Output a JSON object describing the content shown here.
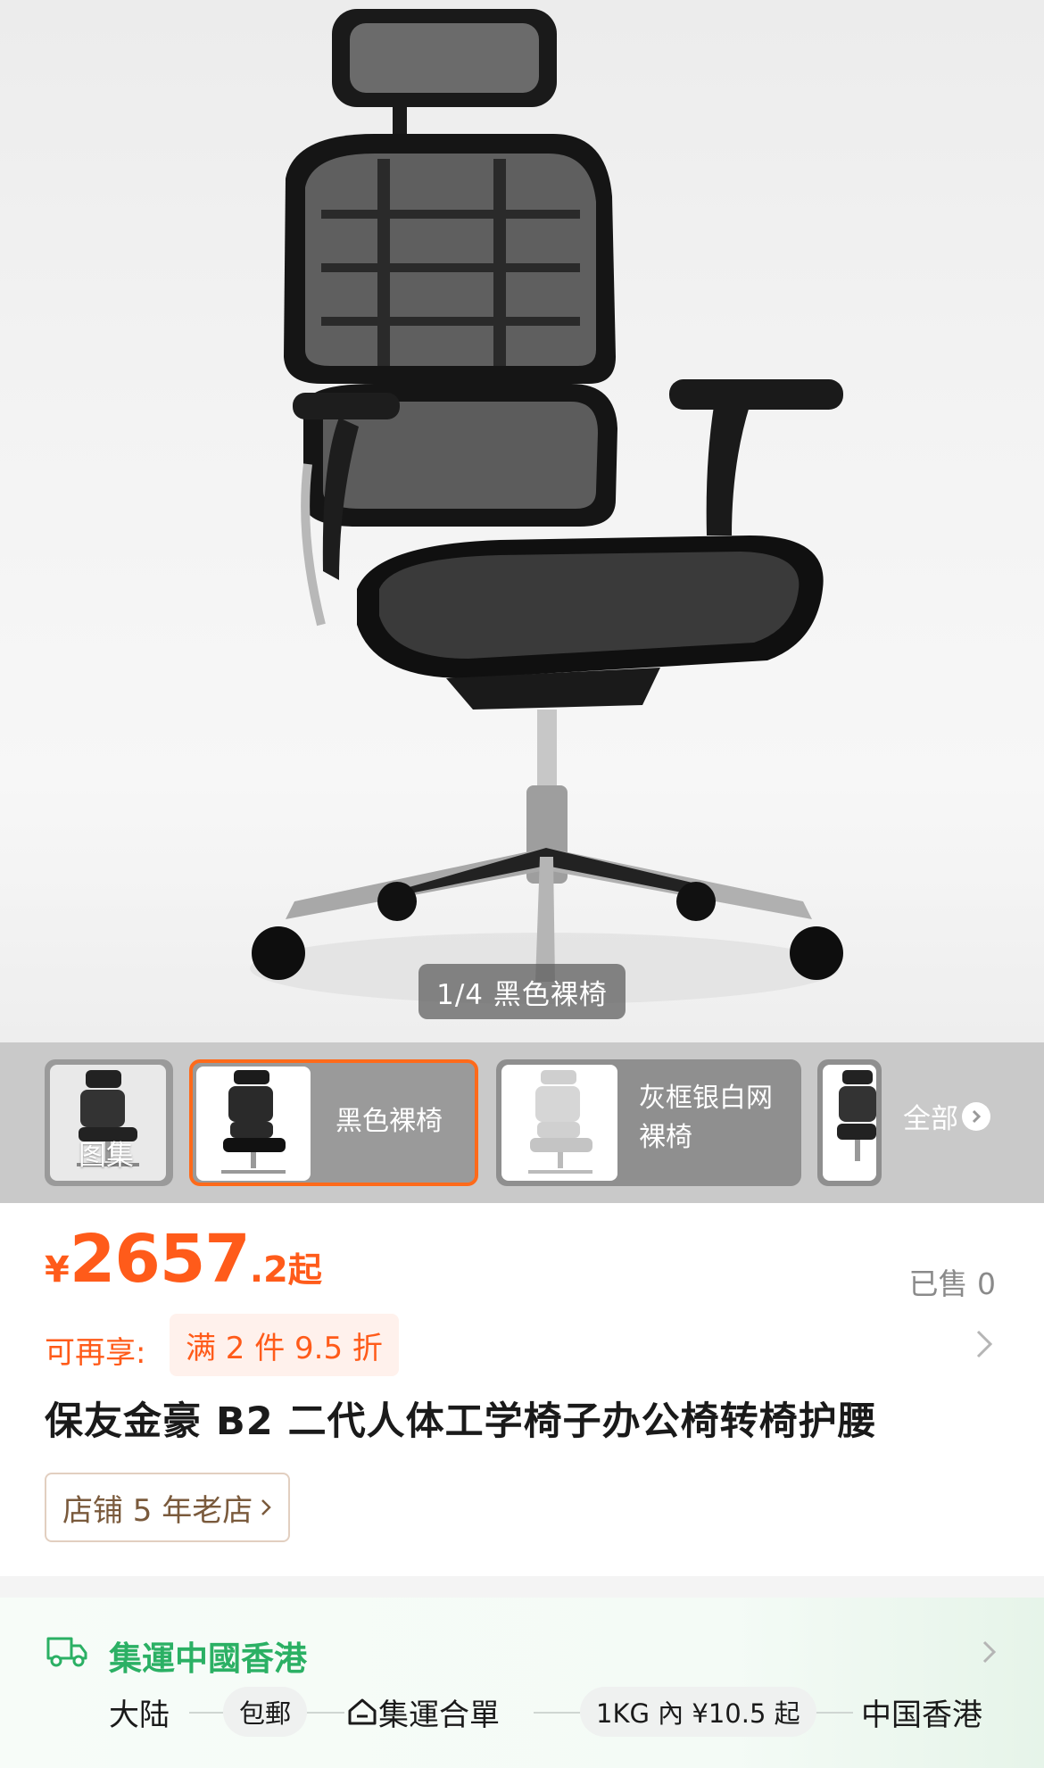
{
  "gallery": {
    "page_indicator": "1/4 黑色裸椅",
    "thumbnails": [
      {
        "label": "图集"
      },
      {
        "label": "黑色裸椅"
      },
      {
        "label": "灰框银白网裸椅"
      },
      {
        "label": ""
      }
    ],
    "all_label": "全部"
  },
  "product": {
    "price_currency": "¥",
    "price_integer": "2657",
    "price_decimal": ".2",
    "price_suffix": "起",
    "sold": "已售 0",
    "promo_label": "可再享:",
    "promo_tag": "满 2 件 9.5 折",
    "title": "保友金豪 B2 二代人体工学椅子办公椅转椅护腰",
    "store_badge": "店铺 5 年老店"
  },
  "shipping": {
    "title": "集運中國香港",
    "route": [
      "大陆",
      "包郵",
      "集運合單",
      "1KG 內 ¥10.5 起",
      "中国香港"
    ]
  },
  "colors": {
    "accent": "#ff5b1a",
    "shipping_green": "#2bb064",
    "selected_border": "#ff6a1a"
  }
}
